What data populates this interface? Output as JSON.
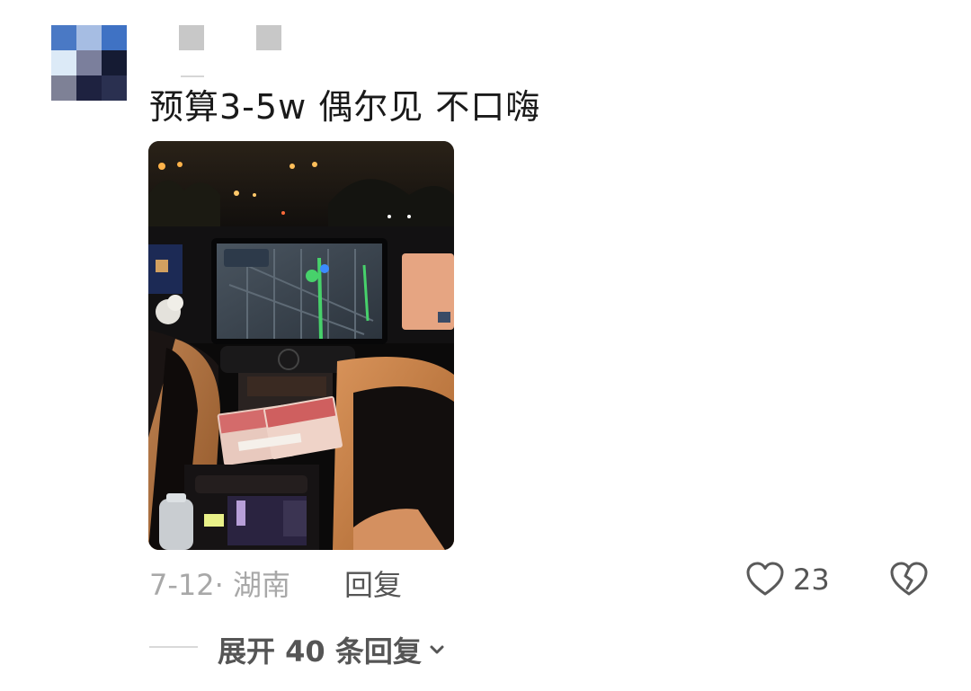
{
  "comment": {
    "text": "预算3-5w  偶尔见  不口嗨",
    "date_location": "7-12· 湖南",
    "reply_label": "回复",
    "like_count": "23",
    "expand_label": "展开 40 条回复"
  },
  "avatar": {
    "mosaic_colors": [
      "#4a79c5",
      "#a6bde3",
      "#3f72c4",
      "#dceaf7",
      "#7b7f9c",
      "#151b33",
      "#7e8196",
      "#1e2240",
      "#2a3050"
    ]
  },
  "icons": {
    "like": "heart-outline-icon",
    "dislike": "broken-heart-icon",
    "expand": "chevron-down-icon"
  },
  "colors": {
    "text_primary": "#1a1a1a",
    "text_secondary": "#555555",
    "text_muted": "#a8a8a8",
    "seat_leather": "#c9844a"
  }
}
